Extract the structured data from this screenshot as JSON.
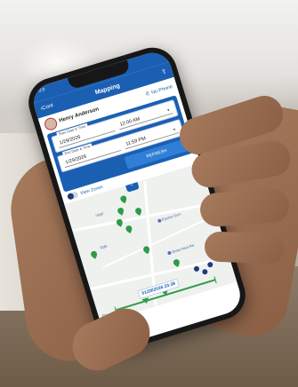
{
  "status_bar": {
    "time": "2:0"
  },
  "nav": {
    "back_label": "Cont",
    "title": "Mapping",
    "action_icon": "export-icon"
  },
  "driver": {
    "name": "Henry Anderson",
    "phone_status": "No Phone"
  },
  "filters": {
    "start_legend": "Start Date & Time",
    "start_date": "1/29/2026",
    "start_time": "12:00 AM",
    "end_legend": "End Date & Time",
    "end_date": "1/29/2026",
    "end_time": "11:59 PM",
    "refresh_label": "REFRESH"
  },
  "zones": {
    "label": "View Zones",
    "enabled": true
  },
  "map": {
    "collapse_icon": "chevron-up-icon",
    "places": [
      "Equitor Dom",
      "Quaa Hara Rd"
    ],
    "roads": [
      "Virgil",
      "Ogle"
    ],
    "timestamp": "01/29/2026 23:38",
    "brand": "Google"
  },
  "colors": {
    "primary": "#1b5fb3",
    "pin_green": "#2e9b4a",
    "pin_blue": "#23387e"
  }
}
